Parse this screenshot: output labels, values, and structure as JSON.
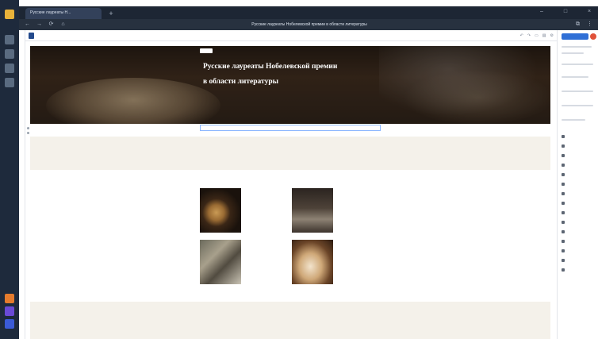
{
  "browser": {
    "tab_title": "Русские лауреаты Н...",
    "new_tab": "+",
    "url": "",
    "page_title": "Русские лауреаты Нобелевской премии в области литературы",
    "nav": {
      "back": "←",
      "forward": "→",
      "reload": "⟳",
      "home": "⌂"
    },
    "window_controls": {
      "minimize": "–",
      "maximize": "□",
      "close": "×"
    },
    "tools": {
      "extensions": "⧉",
      "menu": "⋮"
    }
  },
  "editor": {
    "home_label": "",
    "save_status": "",
    "actions": [
      "↶",
      "↷",
      "▭",
      "▤",
      "⚙"
    ],
    "publish_label": ""
  },
  "hero": {
    "breadcrumb": "",
    "title_line1": "Русские лауреаты Нобелевской премии",
    "title_line2": "в области литературы",
    "subtitle": "",
    "author": ""
  },
  "intro": {
    "heading": "",
    "text": ""
  },
  "cards": [
    {
      "title": "",
      "text": ""
    },
    {
      "title": "",
      "text": ""
    },
    {
      "title": "",
      "text": ""
    },
    {
      "title": "",
      "text": ""
    }
  ],
  "bottom": {
    "heading": "",
    "text": "",
    "link": ""
  },
  "inspector_items": [
    "",
    "",
    "",
    "",
    "",
    "",
    "",
    "",
    "",
    "",
    "",
    "",
    "",
    "",
    "",
    "",
    "",
    "",
    ""
  ],
  "colors": {
    "taskbar": "#1e2a3c",
    "browser_chrome": "#1d2634",
    "accent": "#2f6fd6",
    "section_bg": "#f4f1ea"
  }
}
